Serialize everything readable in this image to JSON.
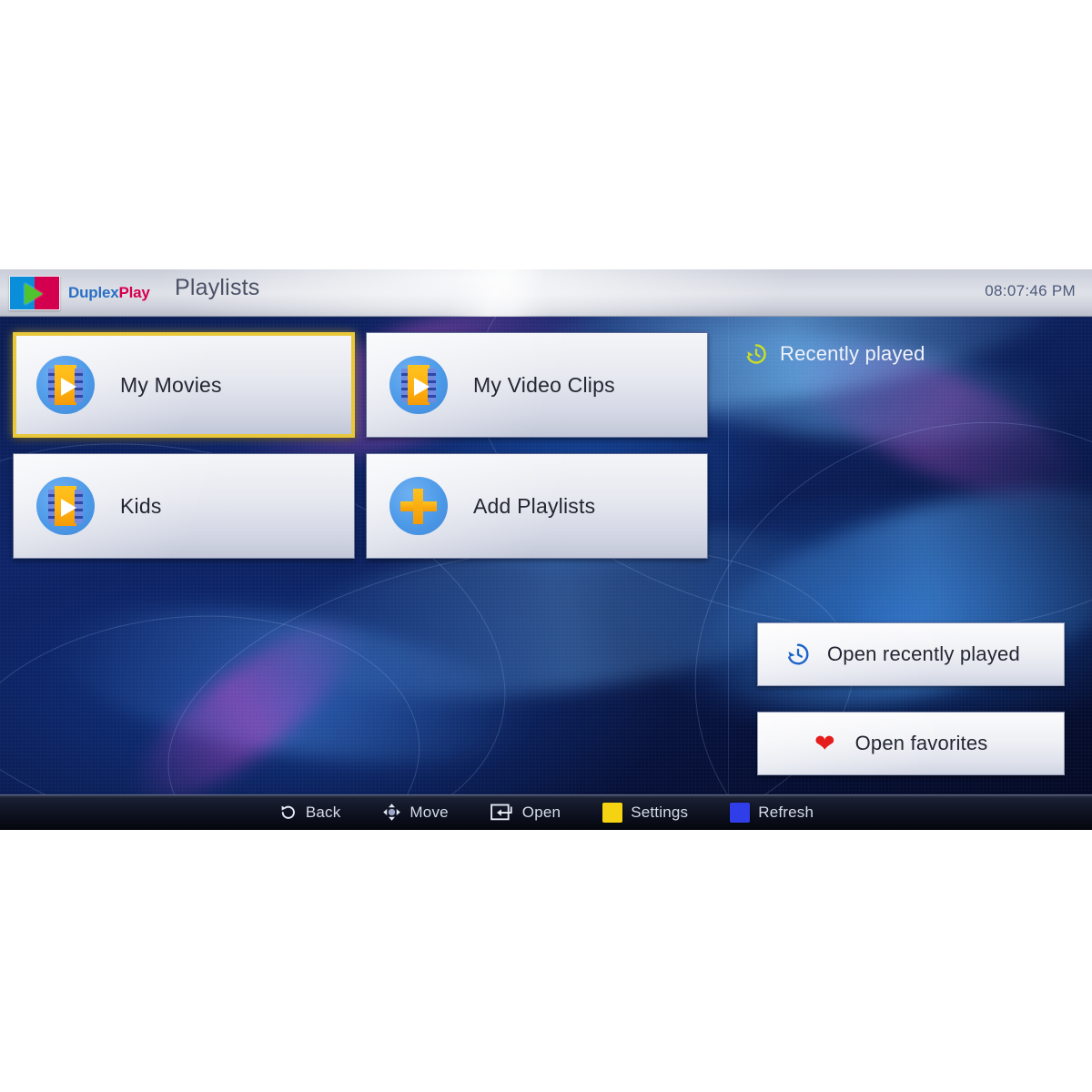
{
  "app": {
    "brand": {
      "part1": "Duplex",
      "part2": "Play",
      "logo_icon": "duplexplay-logo"
    },
    "title": "Playlists",
    "clock": "08:07:46 PM"
  },
  "playlists": {
    "items": [
      {
        "label": "My Movies",
        "icon": "film-play-icon",
        "selected": true
      },
      {
        "label": "My Video Clips",
        "icon": "film-play-icon",
        "selected": false
      },
      {
        "label": "Kids",
        "icon": "film-play-icon",
        "selected": false
      },
      {
        "label": "Add Playlists",
        "icon": "plus-icon",
        "selected": false
      }
    ]
  },
  "recent_panel": {
    "header": {
      "label": "Recently played",
      "icon": "history-clock-icon"
    },
    "actions": [
      {
        "label": "Open recently played",
        "icon": "history-clock-icon"
      },
      {
        "label": "Open favorites",
        "icon": "heart-icon"
      }
    ]
  },
  "bottom_bar": {
    "hints": [
      {
        "label": "Back",
        "icon": "undo-arrow-icon"
      },
      {
        "label": "Move",
        "icon": "dpad-arrows-icon"
      },
      {
        "label": "Open",
        "icon": "enter-key-icon"
      },
      {
        "label": "Settings",
        "icon": "yellow-square-icon",
        "color": "#f5d312"
      },
      {
        "label": "Refresh",
        "icon": "blue-square-icon",
        "color": "#2f3ee8"
      }
    ]
  },
  "colors": {
    "selection_border": "#e8c73a",
    "brand_blue": "#2a6fc4",
    "brand_crimson": "#d4004f",
    "logo_green": "#4fc42e",
    "accent_yellow_green": "#c8dd28",
    "favorite_red": "#e51d1d"
  }
}
